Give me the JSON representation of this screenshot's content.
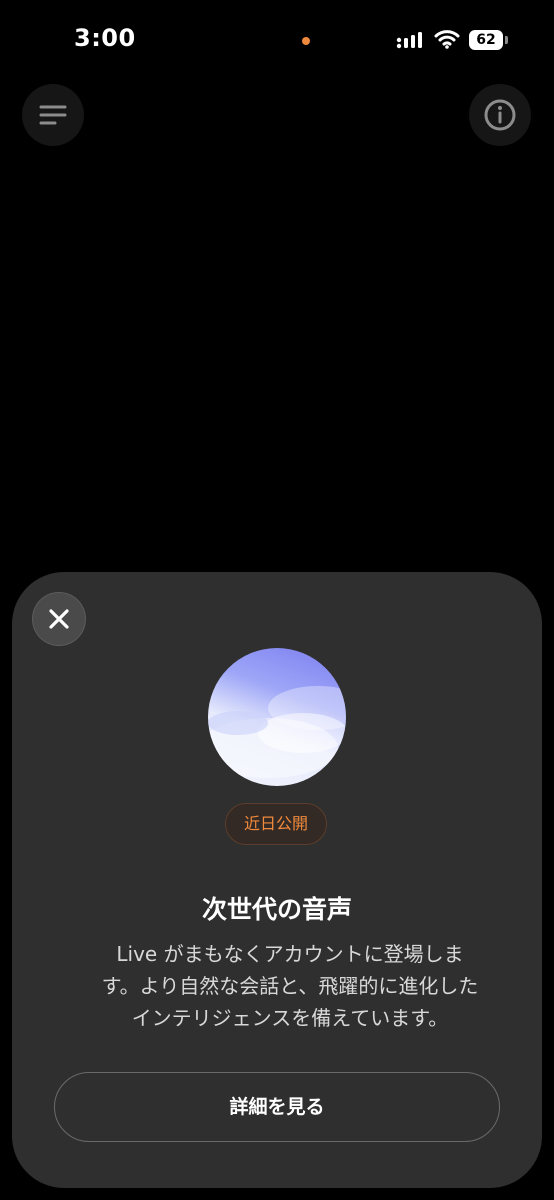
{
  "status_bar": {
    "time": "3:00",
    "battery_level": "62",
    "dot_color": "#f08a3c",
    "icons": [
      "signal-icon",
      "wifi-icon",
      "battery-icon"
    ]
  },
  "top_bar": {
    "icons": [
      "menu-icon",
      "info-icon"
    ]
  },
  "sheet": {
    "close_icon": "close-icon",
    "badge": "近日公開",
    "title": "次世代の音声",
    "description": "Live がまもなくアカウントに登場します。より自然な会話と、飛躍的に進化したインテリジェンスを備えています。",
    "details_button": "詳細を見る",
    "accent_color": "#f08a3c"
  }
}
